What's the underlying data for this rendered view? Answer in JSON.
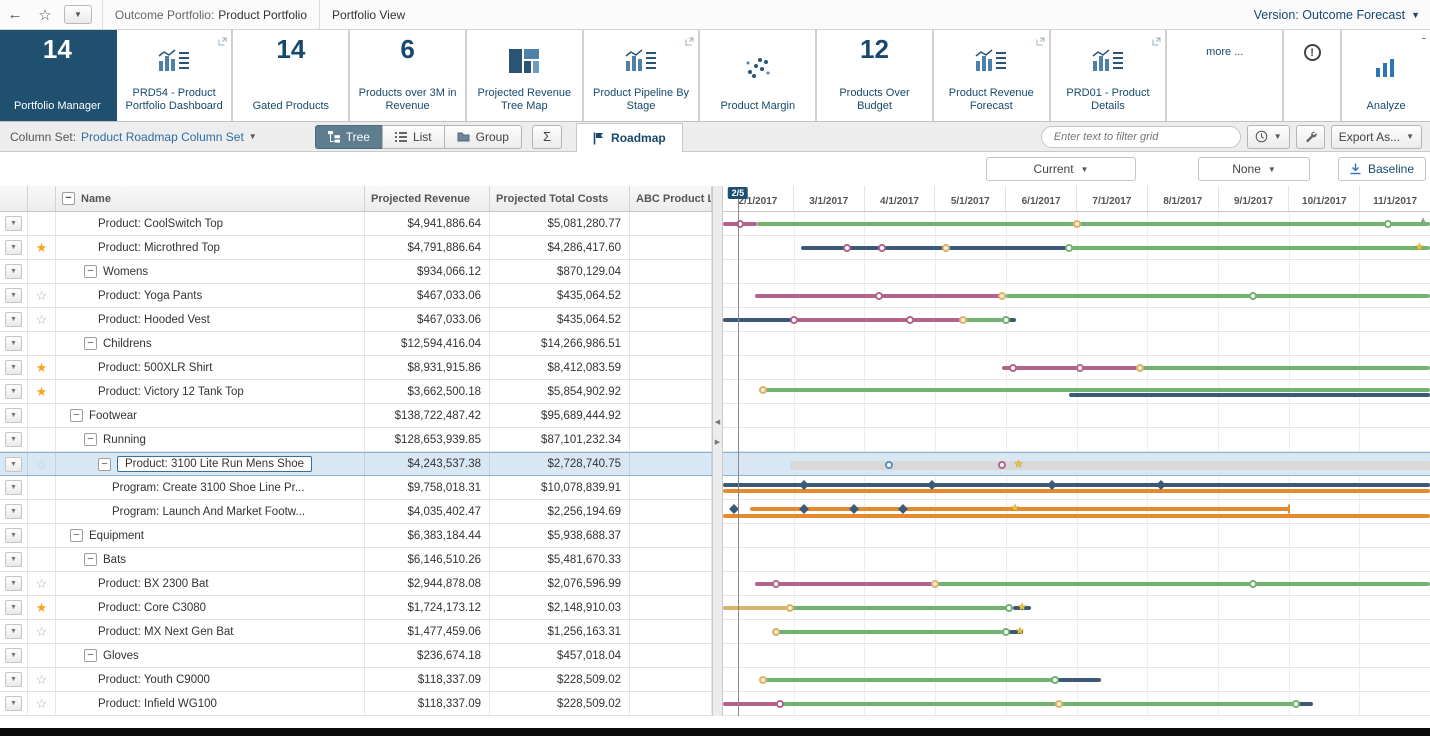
{
  "topbar": {
    "back": "←",
    "favorite": "☆",
    "portfolio_label": "Outcome Portfolio:",
    "portfolio_value": "Product Portfolio",
    "view_label": "Portfolio View",
    "version_label": "Version: Outcome Forecast"
  },
  "tiles": [
    {
      "id": "portfolio-manager",
      "value": "14",
      "label": "Portfolio Manager",
      "type": "metric",
      "selected": true
    },
    {
      "id": "prd54-dashboard",
      "label": "PRD54 - Product Portfolio Dashboard",
      "type": "chart",
      "popout": true
    },
    {
      "id": "gated-products",
      "value": "14",
      "label": "Gated Products",
      "type": "metric"
    },
    {
      "id": "products-over-3m",
      "value": "6",
      "label": "Products over 3M in Revenue",
      "type": "metric"
    },
    {
      "id": "revenue-tree-map",
      "label": "Projected Revenue Tree Map",
      "type": "treemap"
    },
    {
      "id": "pipeline-by-stage",
      "label": "Product Pipeline By Stage",
      "type": "chart",
      "popout": true
    },
    {
      "id": "product-margin",
      "label": "Product Margin",
      "type": "scatter"
    },
    {
      "id": "products-over-budget",
      "value": "12",
      "label": "Products Over Budget",
      "type": "metric"
    },
    {
      "id": "revenue-forecast",
      "label": "Product Revenue Forecast",
      "type": "chart",
      "popout": true
    },
    {
      "id": "prd01-details",
      "label": "PRD01 - Product Details",
      "type": "chart",
      "popout": true
    },
    {
      "id": "more",
      "label": "more ...",
      "type": "more"
    },
    {
      "id": "alert",
      "label": "",
      "type": "alert"
    },
    {
      "id": "analyze",
      "label": "Analyze",
      "type": "analyze"
    }
  ],
  "toolbar": {
    "column_set_label": "Column Set:",
    "column_set_value": "Product Roadmap Column Set",
    "tree_label": "Tree",
    "list_label": "List",
    "group_label": "Group",
    "sigma": "Σ",
    "roadmap_label": "Roadmap",
    "filter_placeholder": "Enter text to filter grid",
    "export_label": "Export As..."
  },
  "controls": {
    "current_label": "Current",
    "none_label": "None",
    "baseline_label": "Baseline"
  },
  "grid": {
    "columns": {
      "name": "Name",
      "revenue": "Projected Revenue",
      "costs": "Projected Total Costs",
      "abc": "ABC Product L"
    },
    "rows": [
      {
        "name": "Product: CoolSwitch Top",
        "indent": 3,
        "star": "none",
        "revenue": "$4,941,886.64",
        "costs": "$5,081,280.77"
      },
      {
        "name": "Product: Microthred Top",
        "indent": 3,
        "star": "orange",
        "revenue": "$4,791,886.64",
        "costs": "$4,286,417.60"
      },
      {
        "name": "Womens",
        "indent": 2,
        "expand": true,
        "star": "none",
        "revenue": "$934,066.12",
        "costs": "$870,129.04"
      },
      {
        "name": "Product: Yoga Pants",
        "indent": 3,
        "star": "gray",
        "revenue": "$467,033.06",
        "costs": "$435,064.52"
      },
      {
        "name": "Product: Hooded Vest",
        "indent": 3,
        "star": "gray",
        "revenue": "$467,033.06",
        "costs": "$435,064.52"
      },
      {
        "name": "Childrens",
        "indent": 2,
        "expand": true,
        "star": "none",
        "revenue": "$12,594,416.04",
        "costs": "$14,266,986.51"
      },
      {
        "name": "Product: 500XLR Shirt",
        "indent": 3,
        "star": "orange",
        "revenue": "$8,931,915.86",
        "costs": "$8,412,083.59"
      },
      {
        "name": "Product: Victory 12 Tank Top",
        "indent": 3,
        "star": "orange",
        "revenue": "$3,662,500.18",
        "costs": "$5,854,902.92"
      },
      {
        "name": "Footwear",
        "indent": 1,
        "expand": true,
        "star": "none",
        "revenue": "$138,722,487.42",
        "costs": "$95,689,444.92"
      },
      {
        "name": "Running",
        "indent": 2,
        "expand": true,
        "star": "none",
        "revenue": "$128,653,939.85",
        "costs": "$87,101,232.34"
      },
      {
        "name": "Product: 3100 Lite Run Mens Shoe",
        "indent": 3,
        "expand": true,
        "star": "pale",
        "selected": true,
        "revenue": "$4,243,537.38",
        "costs": "$2,728,740.75"
      },
      {
        "name": "Program: Create 3100 Shoe Line Pr...",
        "indent": 4,
        "star": "none",
        "revenue": "$9,758,018.31",
        "costs": "$10,078,839.91"
      },
      {
        "name": "Program: Launch And Market Footw...",
        "indent": 4,
        "star": "none",
        "revenue": "$4,035,402.47",
        "costs": "$2,256,194.69"
      },
      {
        "name": "Equipment",
        "indent": 1,
        "expand": true,
        "star": "none",
        "revenue": "$6,383,184.44",
        "costs": "$5,938,688.37"
      },
      {
        "name": "Bats",
        "indent": 2,
        "expand": true,
        "star": "none",
        "revenue": "$6,146,510.26",
        "costs": "$5,481,670.33"
      },
      {
        "name": "Product: BX 2300 Bat",
        "indent": 3,
        "star": "gray",
        "revenue": "$2,944,878.08",
        "costs": "$2,076,596.99"
      },
      {
        "name": "Product: Core C3080",
        "indent": 3,
        "star": "orange",
        "revenue": "$1,724,173.12",
        "costs": "$2,148,910.03"
      },
      {
        "name": "Product: MX Next Gen Bat",
        "indent": 3,
        "star": "gray",
        "revenue": "$1,477,459.06",
        "costs": "$1,256,163.31"
      },
      {
        "name": "Gloves",
        "indent": 2,
        "expand": true,
        "star": "none",
        "revenue": "$236,674.18",
        "costs": "$457,018.04"
      },
      {
        "name": "Product: Youth C9000",
        "indent": 3,
        "star": "gray",
        "revenue": "$118,337.09",
        "costs": "$228,509.02"
      },
      {
        "name": "Product: Infield WG100",
        "indent": 3,
        "star": "gray",
        "revenue": "$118,337.09",
        "costs": "$228,509.02"
      }
    ]
  },
  "gantt": {
    "badge": "2/5",
    "today_pct": 2.1,
    "months": [
      "2/1/2017",
      "3/1/2017",
      "4/1/2017",
      "5/1/2017",
      "6/1/2017",
      "7/1/2017",
      "8/1/2017",
      "9/1/2017",
      "10/1/2017",
      "11/1/2017"
    ],
    "colors": {
      "green": "#72b372",
      "magenta": "#b4638f",
      "orange": "#e68a2e",
      "tan": "#d9b36c",
      "dark": "#3a5a78",
      "blue": "#5b8fbf",
      "lightbar": "#d9d9d9",
      "gold": "#e8c23a"
    },
    "rows": [
      {
        "bars": [
          {
            "s": 0,
            "e": 4.8,
            "c": "magenta"
          },
          {
            "s": 4.8,
            "e": 100,
            "c": "green"
          }
        ],
        "markers": [
          {
            "p": 2.4,
            "t": "circle",
            "c": "magenta"
          },
          {
            "p": 50,
            "t": "circle",
            "c": "tan"
          },
          {
            "p": 94,
            "t": "circle",
            "c": "green"
          }
        ]
      },
      {
        "bars": [
          {
            "s": 11,
            "e": 49,
            "c": "dark"
          },
          {
            "s": 49,
            "e": 100,
            "c": "green"
          }
        ],
        "markers": [
          {
            "p": 17.5,
            "t": "circle",
            "c": "magenta"
          },
          {
            "p": 22.5,
            "t": "circle",
            "c": "magenta"
          },
          {
            "p": 31.5,
            "t": "circle",
            "c": "tan"
          },
          {
            "p": 49,
            "t": "circle",
            "c": "green"
          },
          {
            "p": 98.5,
            "t": "star"
          }
        ]
      },
      {},
      {
        "bars": [
          {
            "s": 4.5,
            "e": 40,
            "c": "magenta"
          },
          {
            "s": 40,
            "e": 100,
            "c": "green"
          }
        ],
        "markers": [
          {
            "p": 22,
            "t": "circle",
            "c": "magenta"
          },
          {
            "p": 39.5,
            "t": "circle",
            "c": "tan"
          },
          {
            "p": 75,
            "t": "circle",
            "c": "green"
          }
        ]
      },
      {
        "bars": [
          {
            "s": 0,
            "e": 10,
            "c": "dark"
          },
          {
            "s": 10,
            "e": 34,
            "c": "magenta"
          },
          {
            "s": 34,
            "e": 40,
            "c": "green"
          },
          {
            "s": 40,
            "e": 41.5,
            "c": "dark"
          }
        ],
        "markers": [
          {
            "p": 10,
            "t": "circle",
            "c": "magenta"
          },
          {
            "p": 26.5,
            "t": "circle",
            "c": "magenta"
          },
          {
            "p": 34,
            "t": "circle",
            "c": "tan"
          },
          {
            "p": 40,
            "t": "circle",
            "c": "green"
          }
        ]
      },
      {},
      {
        "bars": [
          {
            "s": 39.5,
            "e": 59,
            "c": "magenta"
          },
          {
            "s": 59,
            "e": 100,
            "c": "green"
          }
        ],
        "markers": [
          {
            "p": 41,
            "t": "circle",
            "c": "magenta"
          },
          {
            "p": 50.5,
            "t": "circle",
            "c": "magenta"
          },
          {
            "p": 59,
            "t": "circle",
            "c": "tan"
          }
        ]
      },
      {
        "bars": [
          {
            "s": 5.7,
            "e": 100,
            "c": "green",
            "o": -2
          },
          {
            "s": 49,
            "e": 100,
            "c": "dark",
            "o": 3
          }
        ],
        "markers": [
          {
            "p": 5.7,
            "t": "circle",
            "c": "tan",
            "o": -2
          }
        ]
      },
      {},
      {},
      {
        "bars": [
          {
            "s": 9.5,
            "e": 100,
            "c": "lightbar",
            "h": 9
          }
        ],
        "markers": [
          {
            "p": 23.5,
            "t": "circle",
            "c": "blue"
          },
          {
            "p": 39.5,
            "t": "circle",
            "c": "magenta"
          },
          {
            "p": 41.8,
            "t": "star"
          }
        ]
      },
      {
        "bars": [
          {
            "s": 0,
            "e": 100,
            "c": "dark",
            "o": -3
          },
          {
            "s": 0,
            "e": 100,
            "c": "orange",
            "o": 3
          }
        ],
        "markers": [
          {
            "p": 11.5,
            "t": "diamond",
            "o": -3
          },
          {
            "p": 29.5,
            "t": "diamond",
            "o": -3
          },
          {
            "p": 46.5,
            "t": "diamond",
            "o": -3
          },
          {
            "p": 62,
            "t": "diamond",
            "o": -3
          }
        ]
      },
      {
        "bars": [
          {
            "s": 3.8,
            "e": 80,
            "c": "orange",
            "o": -3
          },
          {
            "s": 0,
            "e": 100,
            "c": "orange",
            "o": 4
          }
        ],
        "markers": [
          {
            "p": 1.5,
            "t": "diamond",
            "o": -3
          },
          {
            "p": 11.5,
            "t": "diamond",
            "o": -3
          },
          {
            "p": 18.5,
            "t": "diamond",
            "o": -3
          },
          {
            "p": 25.5,
            "t": "diamond",
            "o": -3
          },
          {
            "p": 41.3,
            "t": "star",
            "o": -3
          },
          {
            "p": 80,
            "t": "tick",
            "o": -3
          }
        ]
      },
      {},
      {},
      {
        "bars": [
          {
            "s": 4.5,
            "e": 30,
            "c": "magenta"
          },
          {
            "s": 30,
            "e": 100,
            "c": "green"
          }
        ],
        "markers": [
          {
            "p": 7.5,
            "t": "circle",
            "c": "magenta"
          },
          {
            "p": 30,
            "t": "circle",
            "c": "tan"
          },
          {
            "p": 75,
            "t": "circle",
            "c": "green"
          }
        ]
      },
      {
        "bars": [
          {
            "s": 0,
            "e": 9.5,
            "c": "tan"
          },
          {
            "s": 9.5,
            "e": 41,
            "c": "green"
          },
          {
            "s": 41,
            "e": 43.5,
            "c": "dark"
          }
        ],
        "markers": [
          {
            "p": 9.5,
            "t": "circle",
            "c": "tan"
          },
          {
            "p": 40.5,
            "t": "circle",
            "c": "green"
          },
          {
            "p": 42.3,
            "t": "star"
          }
        ]
      },
      {
        "bars": [
          {
            "s": 7.5,
            "e": 40,
            "c": "green"
          },
          {
            "s": 40,
            "e": 42.5,
            "c": "dark"
          }
        ],
        "markers": [
          {
            "p": 7.5,
            "t": "circle",
            "c": "tan"
          },
          {
            "p": 40,
            "t": "circle",
            "c": "green"
          },
          {
            "p": 42,
            "t": "star"
          }
        ]
      },
      {},
      {
        "bars": [
          {
            "s": 5.7,
            "e": 47,
            "c": "green"
          },
          {
            "s": 47,
            "e": 53.5,
            "c": "dark"
          }
        ],
        "markers": [
          {
            "p": 5.7,
            "t": "circle",
            "c": "tan"
          },
          {
            "p": 47,
            "t": "circle",
            "c": "green"
          }
        ]
      },
      {
        "bars": [
          {
            "s": 0,
            "e": 8,
            "c": "magenta"
          },
          {
            "s": 8,
            "e": 81,
            "c": "green"
          },
          {
            "s": 81,
            "e": 83.5,
            "c": "dark"
          }
        ],
        "markers": [
          {
            "p": 8,
            "t": "circle",
            "c": "magenta"
          },
          {
            "p": 47.5,
            "t": "circle",
            "c": "tan"
          },
          {
            "p": 81,
            "t": "circle",
            "c": "green"
          }
        ]
      }
    ]
  }
}
